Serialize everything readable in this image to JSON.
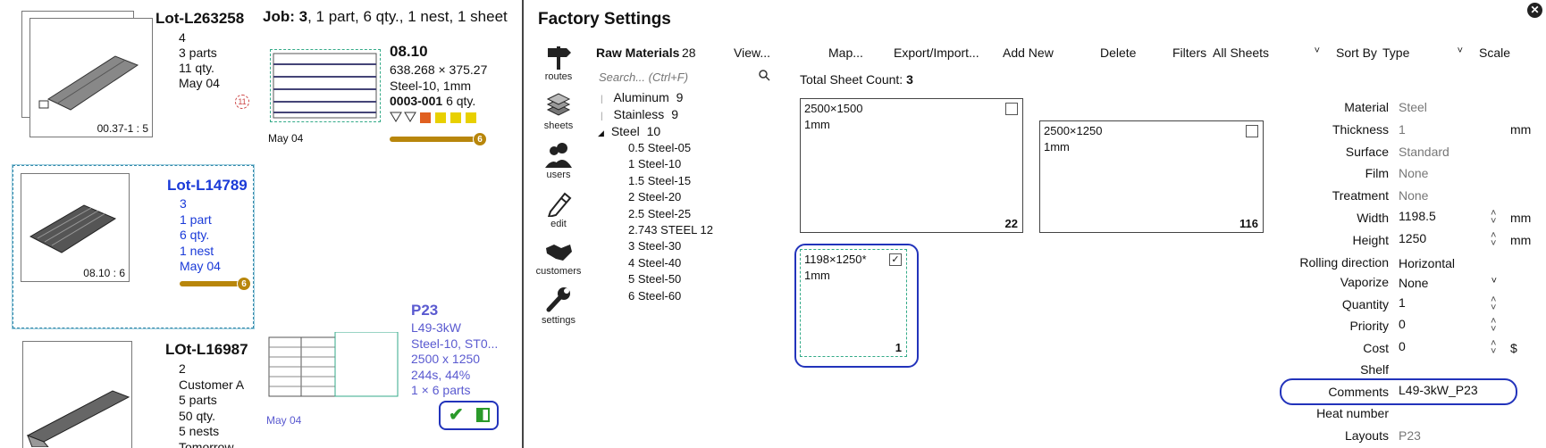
{
  "lots": [
    {
      "name": "Lot-L263258",
      "lines": [
        "4",
        "3 parts",
        "11 qty.",
        "May 04"
      ],
      "thumb_caption": "00.37-1 : 5",
      "badge": "11"
    },
    {
      "name": "Lot-L14789",
      "lines": [
        "3",
        "1 part",
        "6 qty.",
        "1 nest",
        "May 04"
      ],
      "thumb_caption": "08.10 : 6",
      "progress": "6"
    },
    {
      "name": "LOt-L16987",
      "lines": [
        "2",
        "Customer A",
        "5 parts",
        "50 qty.",
        "5 nests",
        "Tomorrow"
      ]
    }
  ],
  "job": {
    "prefix": "Job:",
    "number": "3",
    "summary": ", 1 part, 6 qty., 1 nest, 1 sheet",
    "nest": {
      "name": "08.10",
      "dims": "638.268 × 375.27",
      "material": "Steel-10, 1mm",
      "part_code": "0003-001",
      "part_qty": "6 qty.",
      "date": "May 04",
      "progress": "6"
    }
  },
  "layout_card": {
    "name": "P23",
    "line1": "L49-3kW",
    "line2": "Steel-10, ST0...",
    "line3": "2500 x 1250",
    "line4": "244s, 44%",
    "line5": "1 × 6 parts",
    "date": "May 04"
  },
  "factory": {
    "title": "Factory Settings",
    "nav": [
      {
        "label": "routes",
        "icon": "signpost-icon"
      },
      {
        "label": "sheets",
        "icon": "sheets-stack-icon"
      },
      {
        "label": "users",
        "icon": "users-icon"
      },
      {
        "label": "edit",
        "icon": "pencil-icon"
      },
      {
        "label": "customers",
        "icon": "handshake-icon"
      },
      {
        "label": "settings",
        "icon": "wrench-icon"
      }
    ],
    "raw_materials_label": "Raw Materials",
    "raw_materials_count": "28",
    "toolbar": {
      "view": "View...",
      "map": "Map...",
      "export": "Export/Import...",
      "add": "Add New",
      "delete": "Delete",
      "filters_label": "Filters",
      "filters_value": "All Sheets",
      "sort_label": "Sort By",
      "sort_value": "Type",
      "scale": "Scale"
    },
    "search_placeholder": "Search... (Ctrl+F)",
    "total_sheet_label": "Total Sheet Count:",
    "total_sheet_value": "3",
    "tree": [
      {
        "label": "Aluminum",
        "count": "9"
      },
      {
        "label": "Stainless",
        "count": "9"
      },
      {
        "label": "Steel",
        "count": "10"
      }
    ],
    "steel_children": [
      {
        "size": "0.5",
        "name": "Steel-05"
      },
      {
        "size": "1",
        "name": "Steel-10"
      },
      {
        "size": "1.5",
        "name": "Steel-15"
      },
      {
        "size": "2",
        "name": "Steel-20"
      },
      {
        "size": "2.5",
        "name": "Steel-25"
      },
      {
        "size": "2.743",
        "name": "STEEL 12"
      },
      {
        "size": "3",
        "name": "Steel-30"
      },
      {
        "size": "4",
        "name": "Steel-40"
      },
      {
        "size": "5",
        "name": "Steel-50"
      },
      {
        "size": "6",
        "name": "Steel-60"
      }
    ],
    "sheets": [
      {
        "dims": "2500×1500",
        "thick": "1mm",
        "count": "22",
        "checked": ""
      },
      {
        "dims": "2500×1250",
        "thick": "1mm",
        "count": "116",
        "checked": ""
      },
      {
        "dims": "1198×1250*",
        "thick": "1mm",
        "count": "1",
        "checked": "✓"
      }
    ],
    "properties": [
      {
        "label": "Material",
        "value": "Steel",
        "grey": true
      },
      {
        "label": "Thickness",
        "value": "1",
        "grey": true,
        "unit": "mm"
      },
      {
        "label": "Surface",
        "value": "Standard",
        "grey": true
      },
      {
        "label": "Film",
        "value": "None",
        "grey": true
      },
      {
        "label": "Treatment",
        "value": "None",
        "grey": true
      },
      {
        "label": "Width",
        "value": "1198.5",
        "grey": false,
        "unit": "mm",
        "spin": true
      },
      {
        "label": "Height",
        "value": "1250",
        "grey": false,
        "unit": "mm",
        "spin": true
      },
      {
        "label": "Rolling direction",
        "value": "Horizontal",
        "grey": false
      },
      {
        "label": "Vaporize",
        "value": "None",
        "grey": false,
        "dropdown": true
      },
      {
        "label": "Quantity",
        "value": "1",
        "grey": false,
        "spin": true
      },
      {
        "label": "Priority",
        "value": "0",
        "grey": false,
        "spin": true
      },
      {
        "label": "Cost",
        "value": "0",
        "grey": false,
        "unit": "$",
        "spin": true
      },
      {
        "label": "Shelf",
        "value": "",
        "grey": false
      },
      {
        "label": "Comments",
        "value": "L49-3kW_P23",
        "grey": false
      },
      {
        "label": "Heat number",
        "value": "",
        "grey": false
      },
      {
        "label": "Layouts",
        "value": "P23",
        "grey": true
      }
    ],
    "close_icon": "close-icon",
    "colors": {
      "accent_blue": "#1a3ad8",
      "highlight": "#2233bb",
      "progress": "#b8860b"
    }
  }
}
